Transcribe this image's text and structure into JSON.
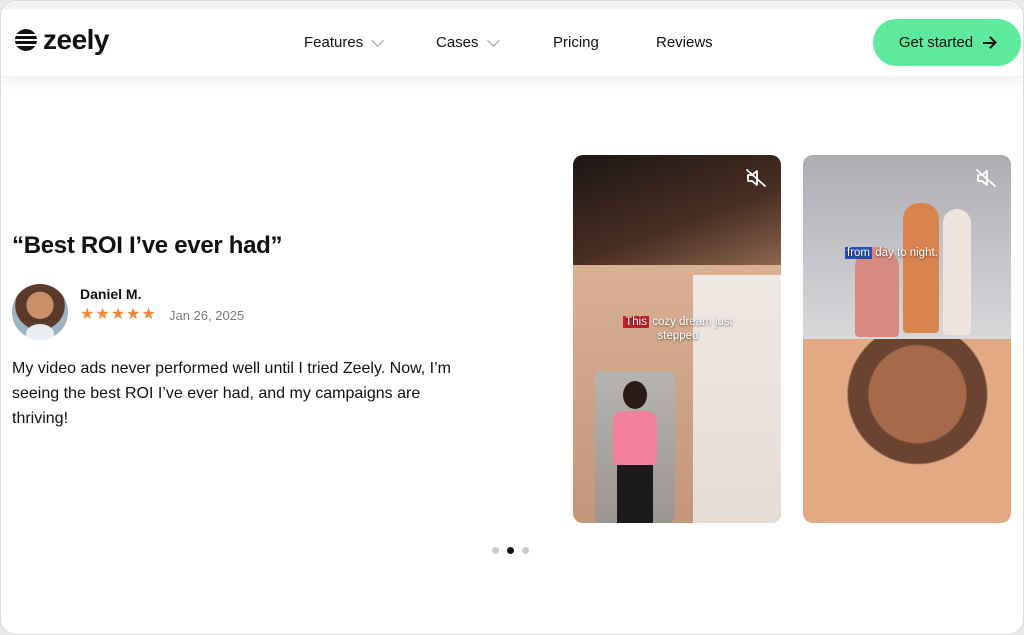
{
  "header": {
    "logo_text": "zeely",
    "nav": [
      {
        "label": "Features",
        "has_dropdown": true
      },
      {
        "label": "Cases",
        "has_dropdown": true
      },
      {
        "label": "Pricing",
        "has_dropdown": false
      },
      {
        "label": "Reviews",
        "has_dropdown": false
      }
    ],
    "cta_label": "Get started",
    "cta_color": "#5eea9c"
  },
  "testimonial": {
    "quote": "“Best ROI I’ve ever had”",
    "author": "Daniel M.",
    "rating": 5,
    "date": "Jan 26, 2025",
    "text": "My video ads never performed well until I tried Zeely. Now, I’m seeing the best ROI I’ve ever had, and my campaigns are thriving!",
    "star_color": "#f5863a"
  },
  "cards": [
    {
      "caption_highlight": "This",
      "caption_rest": "cozy dream just stepped",
      "icon": "mute-icon"
    },
    {
      "caption_highlight": "from",
      "caption_rest": "day to night.",
      "icon": "mute-icon"
    }
  ],
  "carousel": {
    "count": 3,
    "active_index": 1
  }
}
